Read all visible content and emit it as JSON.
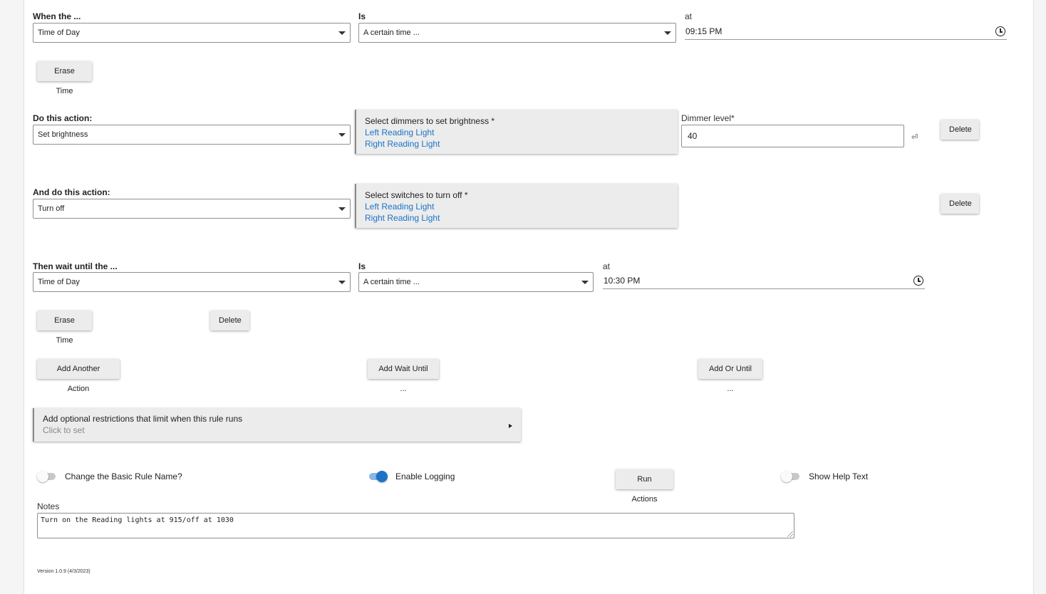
{
  "trigger": {
    "when_label": "When the ...",
    "when_value": "Time of Day",
    "is_label": "Is",
    "is_value": "A certain time ...",
    "at_label": "at",
    "at_value": "09:15 PM",
    "erase_label": "Erase Time"
  },
  "action1": {
    "label": "Do this action:",
    "value": "Set brightness",
    "picker_title": "Select dimmers to set brightness *",
    "devices": [
      "Left Reading Light",
      "Right Reading Light"
    ],
    "dimmer_label": "Dimmer level*",
    "dimmer_value": "40",
    "delete_label": "Delete"
  },
  "action2": {
    "label": "And do this action:",
    "value": "Turn off",
    "picker_title": "Select switches to turn off *",
    "devices": [
      "Left Reading Light",
      "Right Reading Light"
    ],
    "delete_label": "Delete"
  },
  "wait": {
    "label": "Then wait until the ...",
    "value": "Time of Day",
    "is_label": "Is",
    "is_value": "A certain time ...",
    "at_label": "at",
    "at_value": "10:30 PM",
    "erase_label": "Erase Time",
    "delete_label": "Delete"
  },
  "add_buttons": {
    "another_action": "Add Another Action",
    "wait_until": "Add Wait Until ...",
    "or_until": "Add Or Until ..."
  },
  "restrictions": {
    "title": "Add optional restrictions that limit when this rule runs",
    "subtitle": "Click to set"
  },
  "options": {
    "rename_label": "Change the Basic Rule Name?",
    "rename_on": false,
    "logging_label": "Enable Logging",
    "logging_on": true,
    "run_label": "Run Actions",
    "help_label": "Show Help Text",
    "help_on": false
  },
  "notes": {
    "label": "Notes",
    "value": "Turn on the Reading lights at 915/off at 1030"
  },
  "version": "Version 1.0.9 (4/3/2023)",
  "icons": [
    "chevron-down-icon",
    "clock-icon",
    "enter-icon",
    "play-arrow-icon",
    "resize-grip-icon"
  ],
  "colors": {
    "link": "#1a73c8",
    "toggle_on": "#1a73c8",
    "button_bg": "#ececec"
  }
}
